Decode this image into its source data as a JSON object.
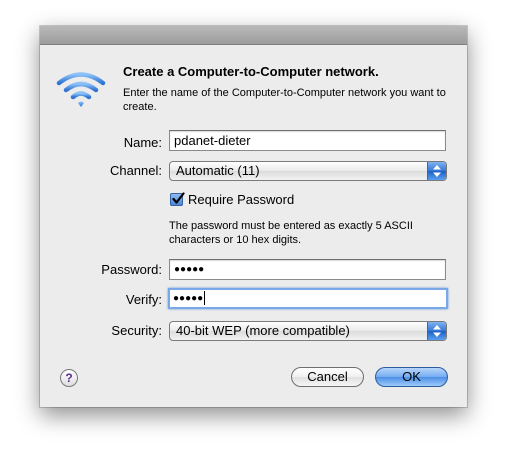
{
  "dialog": {
    "heading": "Create a Computer-to-Computer network.",
    "description": "Enter the name of the Computer-to-Computer network you want to create."
  },
  "fields": {
    "name_label": "Name:",
    "name_value": "pdanet-dieter",
    "channel_label": "Channel:",
    "channel_value": "Automatic (11)",
    "require_password_label": "Require Password",
    "require_password_checked": true,
    "password_note": "The password must be entered as exactly 5 ASCII characters or 10 hex digits.",
    "password_label": "Password:",
    "password_value": "●●●●●",
    "verify_label": "Verify:",
    "verify_value": "●●●●●",
    "security_label": "Security:",
    "security_value": "40-bit WEP (more compatible)"
  },
  "buttons": {
    "help_label": "?",
    "cancel_label": "Cancel",
    "ok_label": "OK"
  },
  "icons": {
    "network": "wifi-icon",
    "help": "help-icon",
    "popup_arrows": "up-down-arrows-icon",
    "checkmark": "checkmark-icon"
  },
  "colors": {
    "wifi": "#4a8fe0",
    "accent": "#4c8ee6",
    "sheet_bg": "#ececec"
  }
}
